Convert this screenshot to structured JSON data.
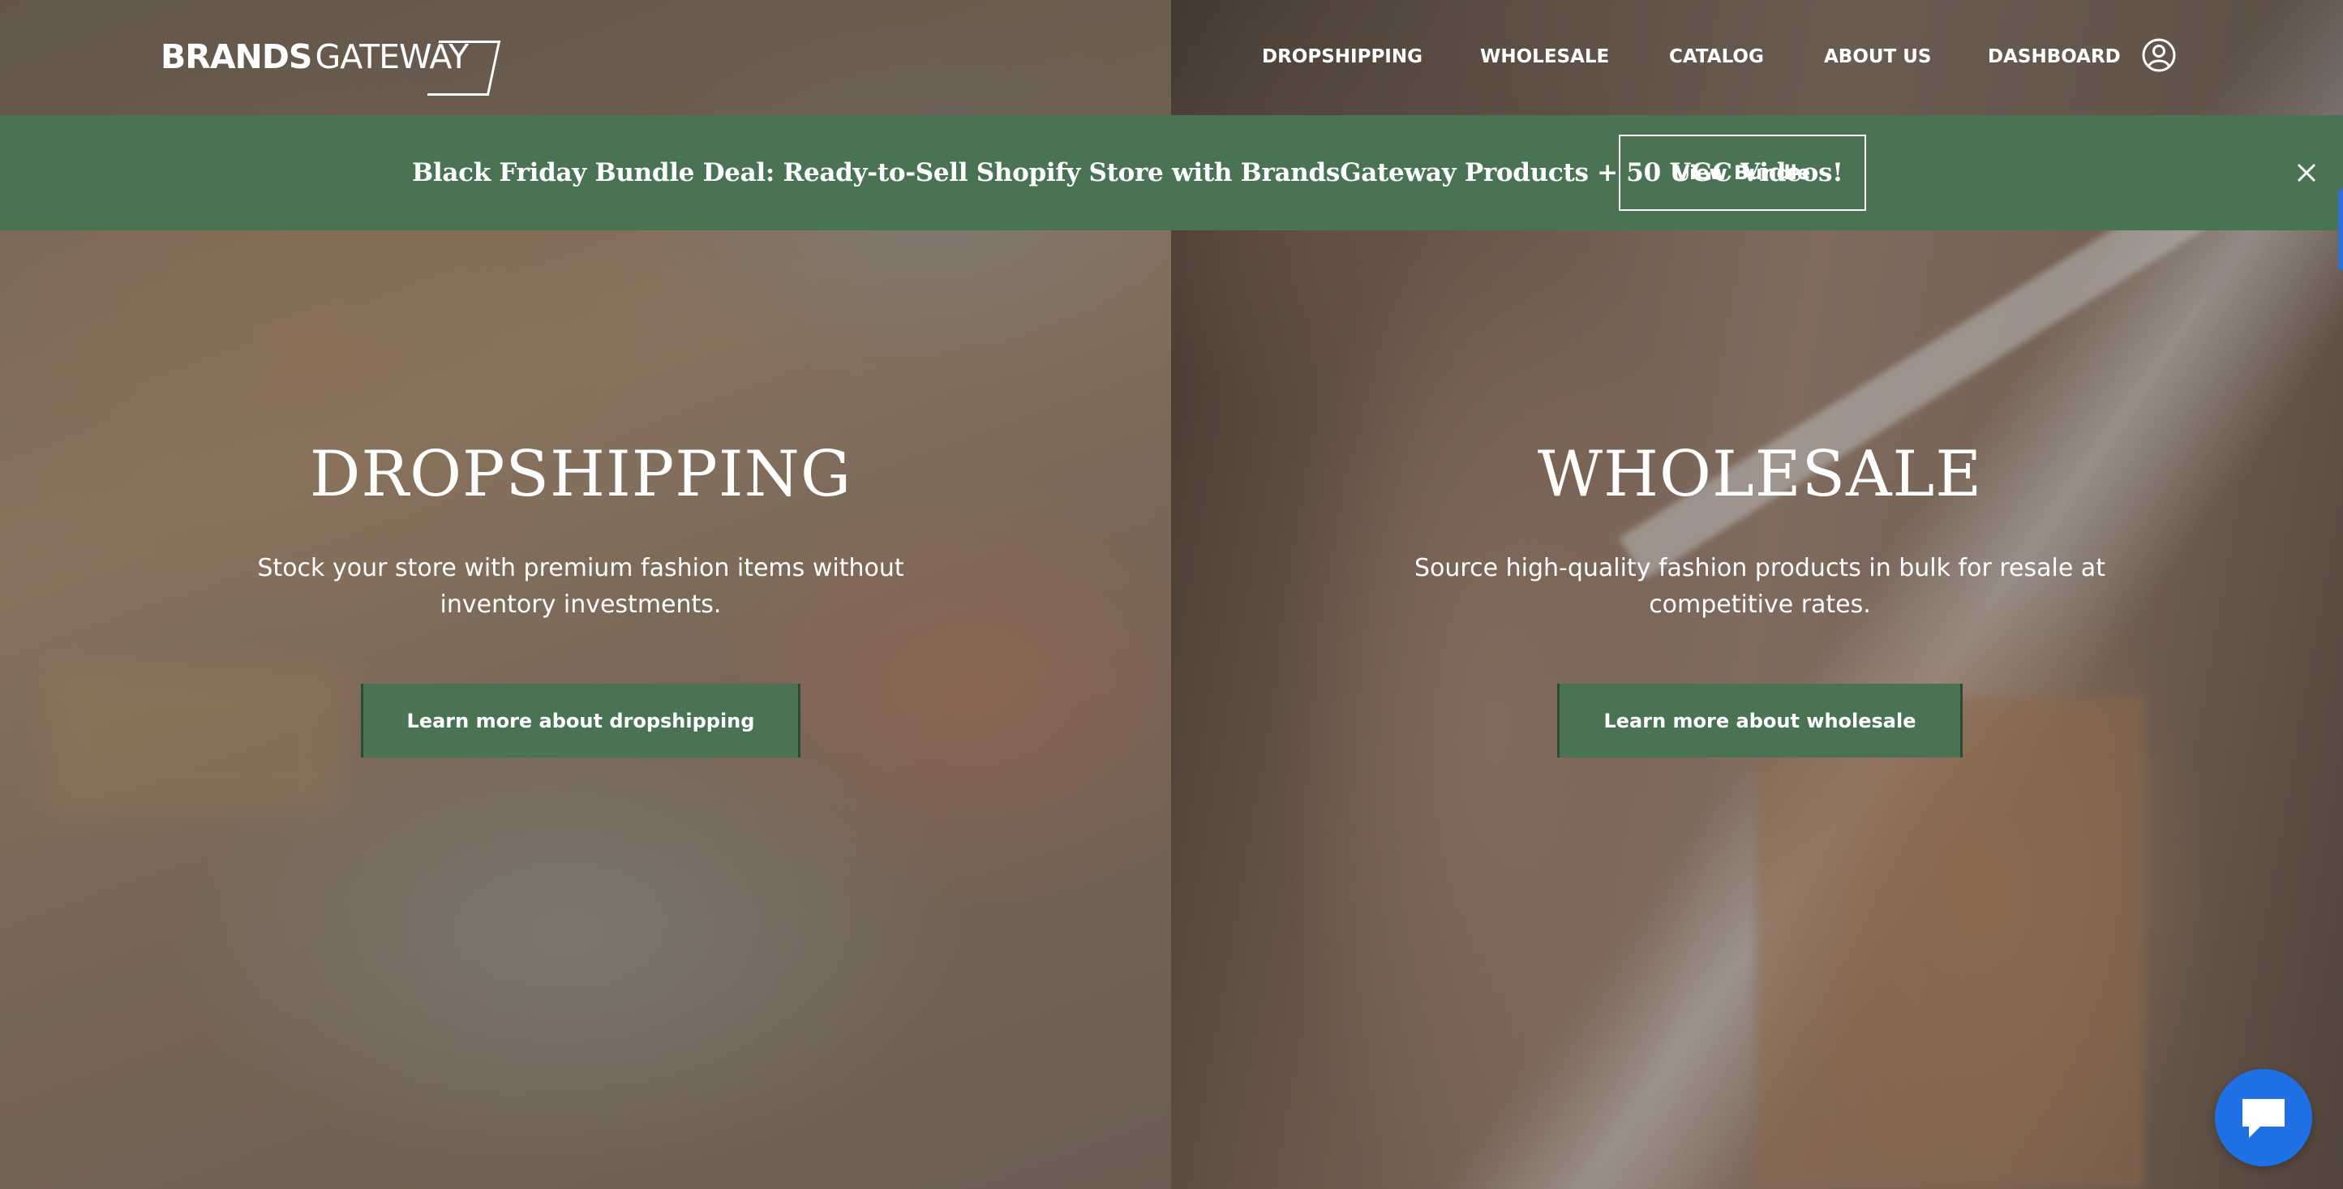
{
  "header": {
    "logo": {
      "brands": "BRANDS",
      "gateway": "GATEWAY"
    },
    "nav": [
      {
        "label": "DROPSHIPPING"
      },
      {
        "label": "WHOLESALE"
      },
      {
        "label": "CATALOG"
      },
      {
        "label": "ABOUT US"
      },
      {
        "label": "DASHBOARD"
      }
    ],
    "user_icon": "user-circle-icon"
  },
  "promo": {
    "text": "Black Friday Bundle Deal: Ready-to-Sell Shopify Store with BrandsGateway Products + 50 UGC Videos!",
    "button_label": "View Bundle",
    "close_icon": "close-icon",
    "background_color": "#4a7354"
  },
  "hero": {
    "dropshipping": {
      "title": "DROPSHIPPING",
      "description": "Stock your store with premium fashion items without inventory investments.",
      "button_label": "Learn more about dropshipping"
    },
    "wholesale": {
      "title": "WHOLESALE",
      "description": "Source high-quality fashion products in bulk for resale at competitive rates.",
      "button_label": "Learn more about wholesale"
    }
  },
  "chat": {
    "icon": "chat-bubble-icon",
    "color": "#1f6fe5"
  },
  "colors": {
    "accent_green": "#4a7354",
    "text": "#ffffff"
  }
}
